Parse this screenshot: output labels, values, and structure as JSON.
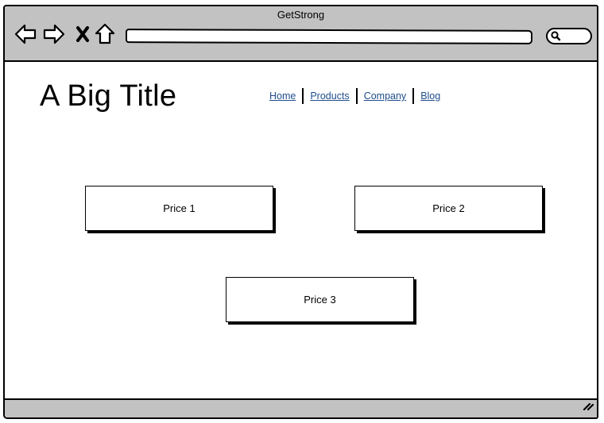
{
  "window": {
    "title": "GetStrong"
  },
  "toolbar": {
    "back_icon": "back-arrow-icon",
    "forward_icon": "forward-arrow-icon",
    "stop_icon": "close-x-icon",
    "home_icon": "home-icon",
    "url_value": "",
    "search_icon": "search-icon",
    "search_value": ""
  },
  "page": {
    "title": "A Big Title",
    "nav": [
      {
        "label": "Home"
      },
      {
        "label": "Products"
      },
      {
        "label": "Company"
      },
      {
        "label": "Blog"
      }
    ],
    "prices": [
      {
        "label": "Price 1"
      },
      {
        "label": "Price 2"
      },
      {
        "label": "Price 3"
      }
    ]
  },
  "colors": {
    "chrome": "#c2c2c2",
    "link": "#1f4e8c",
    "border": "#000000",
    "background": "#ffffff"
  }
}
